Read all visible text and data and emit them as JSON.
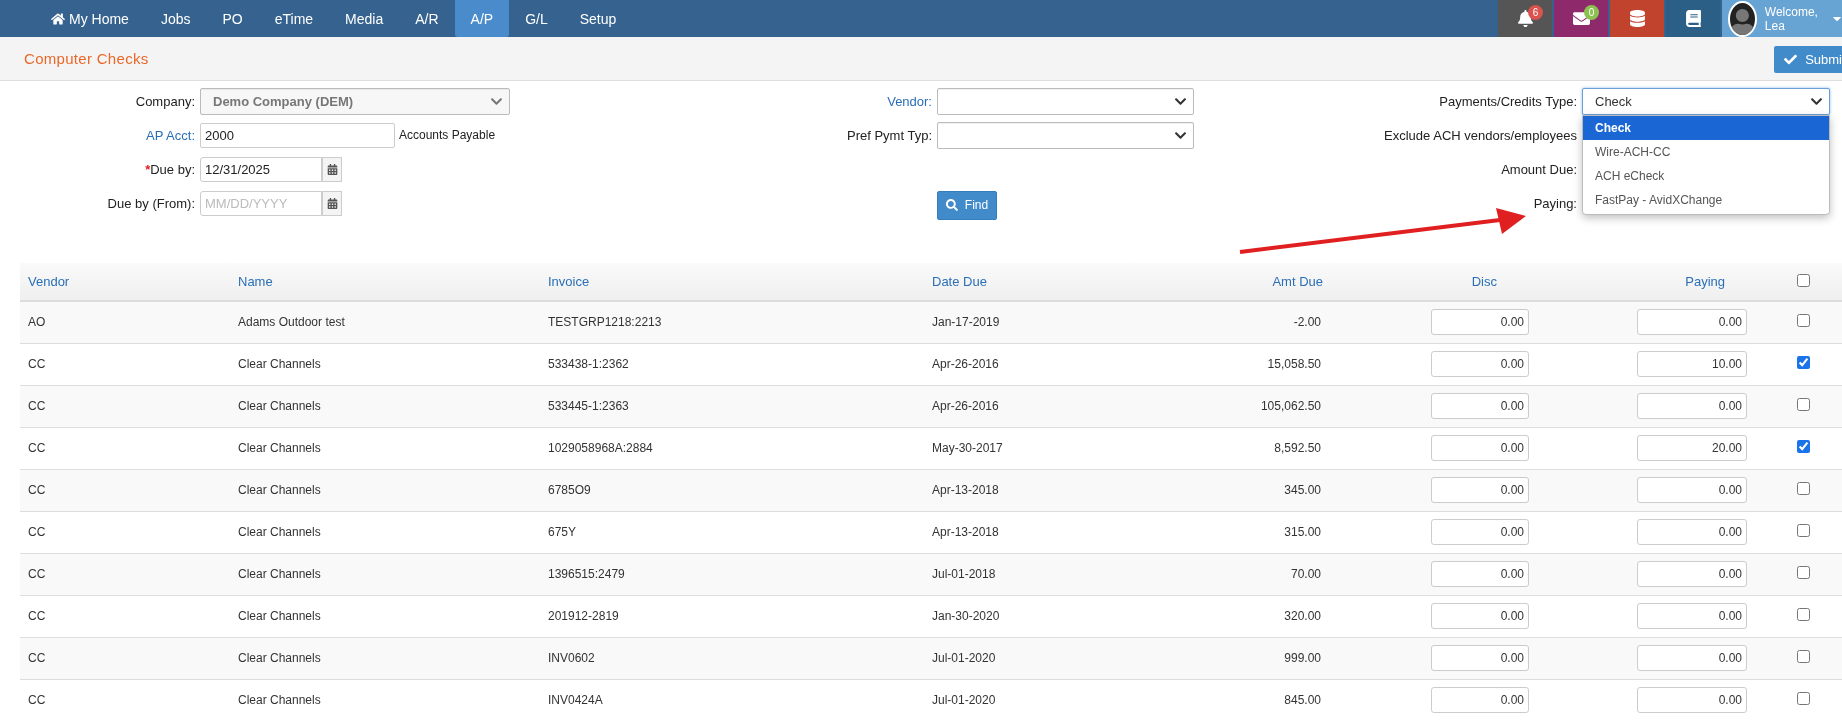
{
  "nav": {
    "items": [
      {
        "label": "My Home",
        "kind": "home",
        "selected": false
      },
      {
        "label": "Jobs",
        "kind": "text",
        "selected": false
      },
      {
        "label": "PO",
        "kind": "text",
        "selected": false
      },
      {
        "label": "eTime",
        "kind": "text",
        "selected": false
      },
      {
        "label": "Media",
        "kind": "text",
        "selected": false
      },
      {
        "label": "A/R",
        "kind": "text",
        "selected": false
      },
      {
        "label": "A/P",
        "kind": "text",
        "selected": true
      },
      {
        "label": "G/L",
        "kind": "text",
        "selected": false
      },
      {
        "label": "Setup",
        "kind": "text",
        "selected": false
      }
    ],
    "tools": [
      {
        "kind": "bell",
        "badge": "6",
        "color": "#555555"
      },
      {
        "kind": "mail",
        "badge": "0",
        "color": "#8e2a6c"
      },
      {
        "kind": "database",
        "color": "#c1432e"
      },
      {
        "kind": "book",
        "color": "#2b5f86"
      }
    ],
    "user": {
      "greeting": "Welcome,",
      "name": "Lea"
    }
  },
  "page": {
    "title": "Computer Checks",
    "submit_label": "Submi"
  },
  "form": {
    "company": {
      "label": "Company:",
      "value": "Demo Company (DEM)",
      "disabled": true
    },
    "ap_acct": {
      "label": "AP Acct:",
      "value": "2000",
      "description": "Accounts Payable"
    },
    "due_by": {
      "required_mark": "*",
      "label": "Due by:",
      "value": "12/31/2025"
    },
    "due_by_from": {
      "label": "Due by (From):",
      "placeholder": "MM/DD/YYYY"
    },
    "vendor": {
      "label": "Vendor:"
    },
    "pref_pymt_typ": {
      "label": "Pref Pymt Typ:"
    },
    "find_button": "Find",
    "payment_type": {
      "label": "Payments/Credits Type:",
      "value": "Check",
      "expanded": true,
      "options": [
        {
          "label": "Check",
          "selected": true
        },
        {
          "label": "Wire-ACH-CC",
          "selected": false
        },
        {
          "label": "ACH eCheck",
          "selected": false
        },
        {
          "label": "FastPay - AvidXChange",
          "selected": false
        }
      ]
    },
    "exclude_ach": {
      "label": "Exclude ACH vendors/employees"
    },
    "amount_due": {
      "label": "Amount Due:"
    },
    "paying": {
      "label": "Paying:"
    }
  },
  "table": {
    "columns": [
      "Vendor",
      "Name",
      "Invoice",
      "Date Due",
      "Amt Due",
      "Disc",
      "Paying"
    ],
    "select_all_checked": false,
    "rows": [
      {
        "vendor": "AO",
        "name": "Adams Outdoor test",
        "invoice": "TESTGRP1218:2213",
        "date_due": "Jan-17-2019",
        "amt_due": "-2.00",
        "disc": "0.00",
        "paying": "0.00",
        "checked": false
      },
      {
        "vendor": "CC",
        "name": "Clear Channels",
        "invoice": "533438-1:2362",
        "date_due": "Apr-26-2016",
        "amt_due": "15,058.50",
        "disc": "0.00",
        "paying": "10.00",
        "checked": true
      },
      {
        "vendor": "CC",
        "name": "Clear Channels",
        "invoice": "533445-1:2363",
        "date_due": "Apr-26-2016",
        "amt_due": "105,062.50",
        "disc": "0.00",
        "paying": "0.00",
        "checked": false
      },
      {
        "vendor": "CC",
        "name": "Clear Channels",
        "invoice": "1029058968A:2884",
        "date_due": "May-30-2017",
        "amt_due": "8,592.50",
        "disc": "0.00",
        "paying": "20.00",
        "checked": true
      },
      {
        "vendor": "CC",
        "name": "Clear Channels",
        "invoice": "6785O9",
        "date_due": "Apr-13-2018",
        "amt_due": "345.00",
        "disc": "0.00",
        "paying": "0.00",
        "checked": false
      },
      {
        "vendor": "CC",
        "name": "Clear Channels",
        "invoice": "675Y",
        "date_due": "Apr-13-2018",
        "amt_due": "315.00",
        "disc": "0.00",
        "paying": "0.00",
        "checked": false
      },
      {
        "vendor": "CC",
        "name": "Clear Channels",
        "invoice": "1396515:2479",
        "date_due": "Jul-01-2018",
        "amt_due": "70.00",
        "disc": "0.00",
        "paying": "0.00",
        "checked": false
      },
      {
        "vendor": "CC",
        "name": "Clear Channels",
        "invoice": "201912-2819",
        "date_due": "Jan-30-2020",
        "amt_due": "320.00",
        "disc": "0.00",
        "paying": "0.00",
        "checked": false
      },
      {
        "vendor": "CC",
        "name": "Clear Channels",
        "invoice": "INV0602",
        "date_due": "Jul-01-2020",
        "amt_due": "999.00",
        "disc": "0.00",
        "paying": "0.00",
        "checked": false
      },
      {
        "vendor": "CC",
        "name": "Clear Channels",
        "invoice": "INV0424A",
        "date_due": "Jul-01-2020",
        "amt_due": "845.00",
        "disc": "0.00",
        "paying": "0.00",
        "checked": false
      }
    ]
  }
}
